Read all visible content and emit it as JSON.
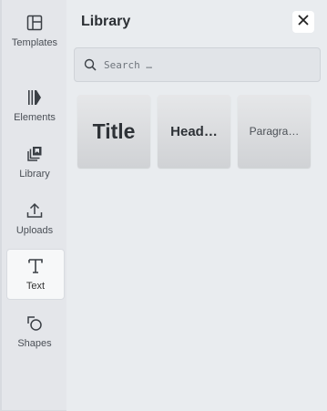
{
  "sidebar": {
    "items": [
      {
        "label": "Templates",
        "icon": "templates-icon"
      },
      {
        "label": "Elements",
        "icon": "elements-icon"
      },
      {
        "label": "Library",
        "icon": "library-icon"
      },
      {
        "label": "Uploads",
        "icon": "upload-icon"
      },
      {
        "label": "Text",
        "icon": "text-icon",
        "active": true
      },
      {
        "label": "Shapes",
        "icon": "shapes-icon"
      }
    ]
  },
  "panel": {
    "title": "Library",
    "close_icon": "close-icon",
    "search": {
      "placeholder": "Search …",
      "value": ""
    },
    "cards": [
      {
        "label": "Title"
      },
      {
        "label": "Head…"
      },
      {
        "label": "Paragra…"
      }
    ]
  },
  "colors": {
    "background": "#e9ecef",
    "sidebar": "#e4e6ea",
    "active_item": "#f7f8f9",
    "text": "#2b2f34"
  }
}
